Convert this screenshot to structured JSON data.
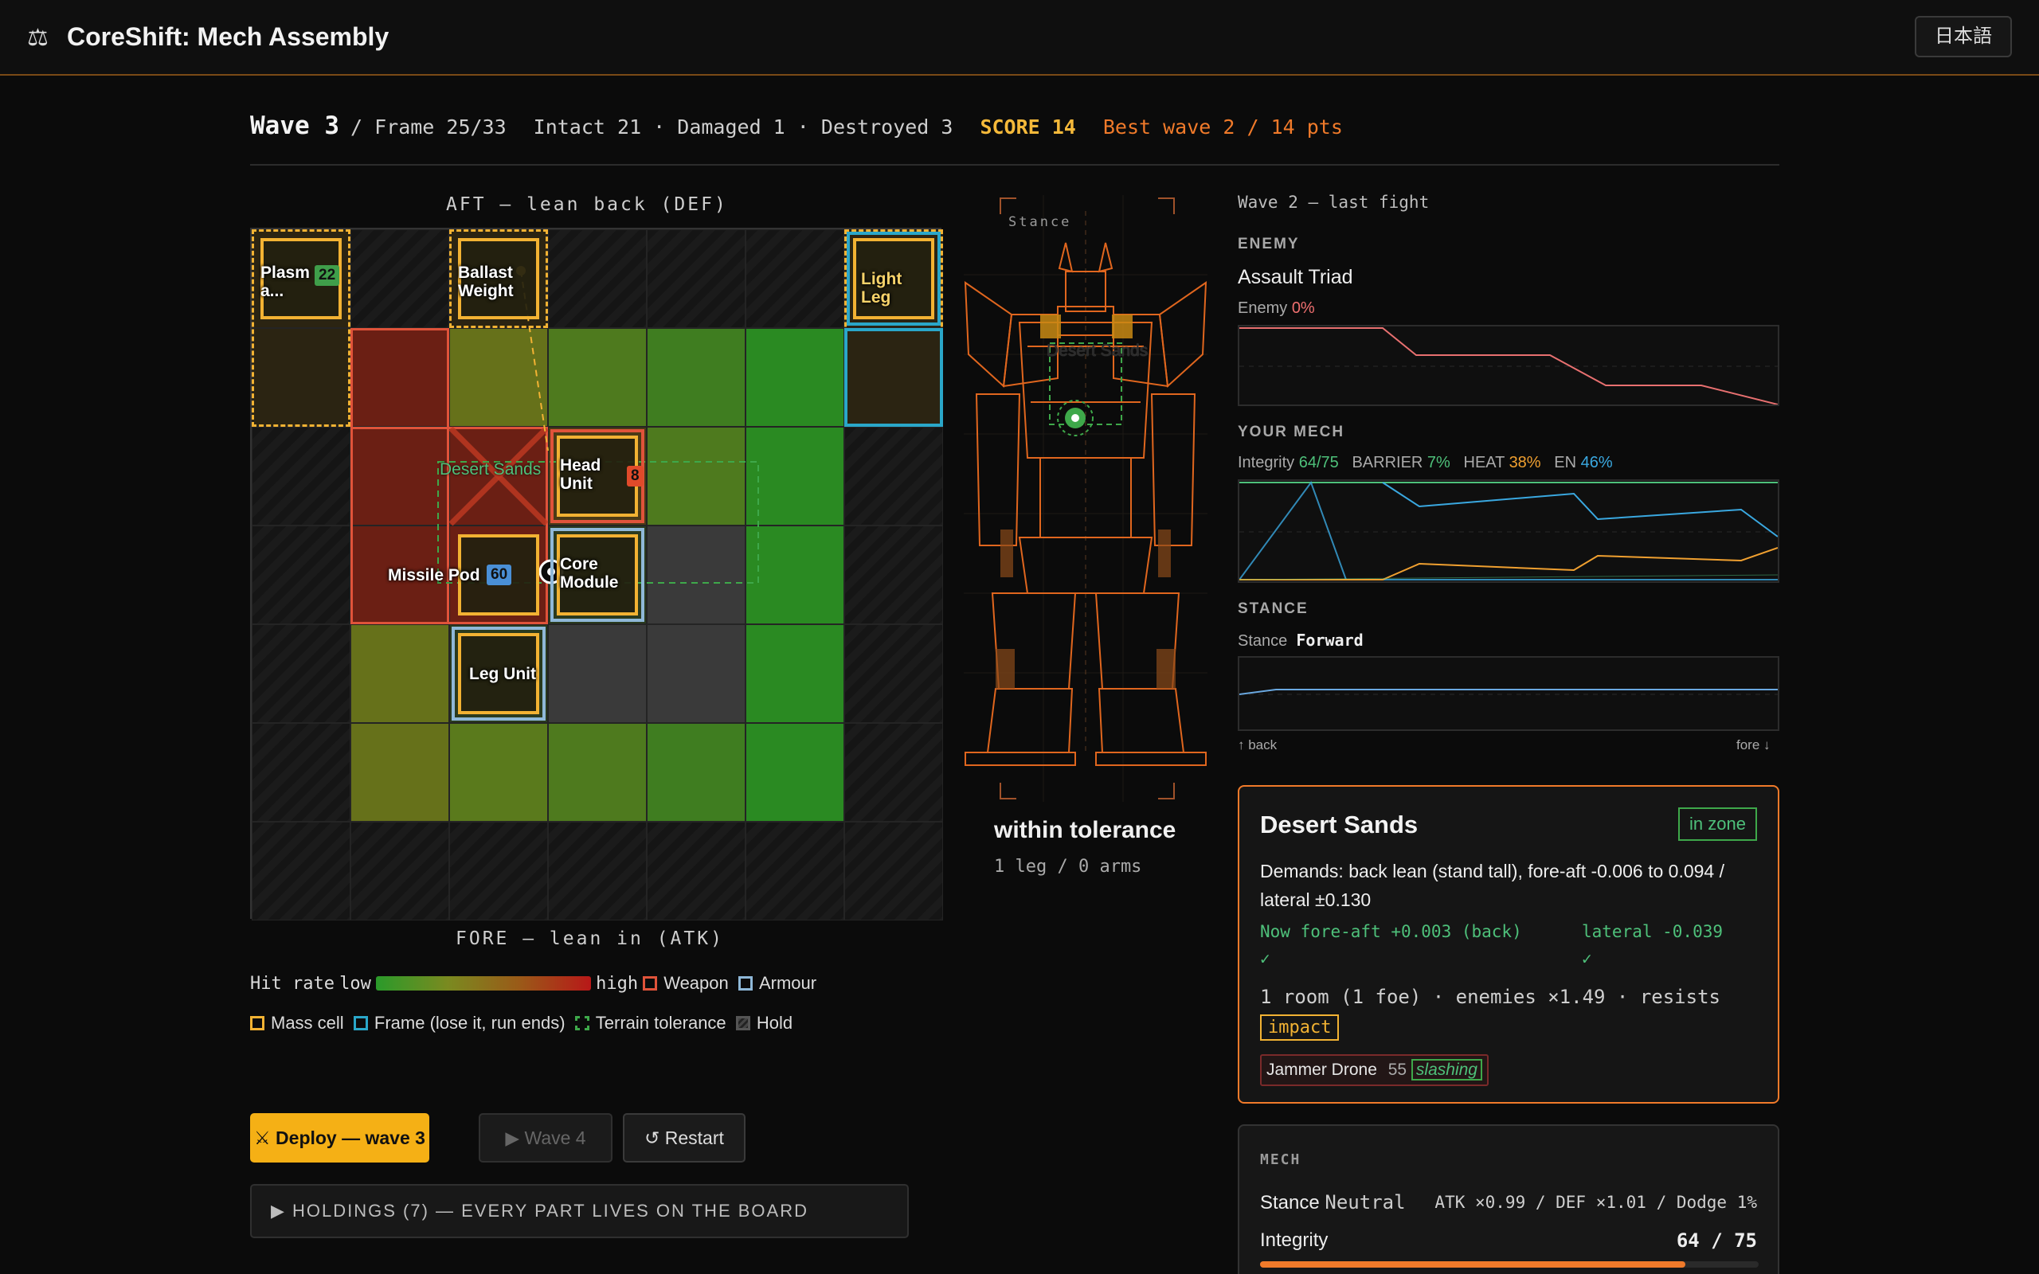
{
  "header": {
    "logo": "⚖",
    "title": "CoreShift: Mech Assembly",
    "lang_button": "日本語"
  },
  "status": {
    "wave": "Wave 3",
    "frame": "/ Frame 25/33",
    "counts": "Intact 21 · Damaged 1 · Destroyed 3",
    "score": "SCORE 14",
    "best": "Best wave 2 / 14 pts"
  },
  "board": {
    "top_label": "AFT — lean back (DEF)",
    "bottom_label": "FORE — lean in (ATK)",
    "terrain_zone_label": "Desert Sands",
    "pieces": [
      {
        "name": "Plasma...",
        "label": "Plasm\na...",
        "badge": "22",
        "badge_color": "#3f9e4a"
      },
      {
        "name": "Ballast Weight",
        "label": "Ballast\nWeight"
      },
      {
        "name": "Light Leg",
        "label": "Light Leg"
      },
      {
        "name": "Head Unit",
        "label": "Head\nUnit",
        "badge": "8",
        "badge_color": "#e04a2a"
      },
      {
        "name": "Missile Pod",
        "label": "Missile Pod",
        "badge": "60",
        "badge_color": "#4a8fd6"
      },
      {
        "name": "Core Module",
        "label": "Core\nModule"
      },
      {
        "name": "Leg Unit",
        "label": "Leg Unit"
      }
    ]
  },
  "legend": {
    "hit_rate": "Hit rate",
    "low": "low",
    "high": "high",
    "weapon": "Weapon",
    "armour": "Armour",
    "mass_cell": "Mass cell",
    "frame": "Frame (lose it, run ends)",
    "terrain": "Terrain tolerance",
    "hold": "Hold"
  },
  "buttons": {
    "deploy": "⚔ Deploy — wave 3",
    "wave4": "▶ Wave 4",
    "restart": "↺ Restart"
  },
  "holdings": "▶ HOLDINGS (7) — EVERY PART LIVES ON THE BOARD",
  "mech": {
    "stance_caption": "Stance",
    "terrain_overlay": "Desert Sands",
    "tolerance": "within tolerance",
    "limbs": "1 leg / 0 arms"
  },
  "panel": {
    "last_fight": "Wave 2 — last fight",
    "enemy_heading": "ENEMY",
    "enemy_name": "Assault Triad",
    "enemy_label": "Enemy",
    "enemy_value": "0%",
    "your_mech_heading": "YOUR MECH",
    "integrity_label": "Integrity",
    "integrity_value": "64/75",
    "barrier_label": "BARRIER",
    "barrier_value": "7%",
    "heat_label": "HEAT",
    "heat_value": "38%",
    "en_label": "EN",
    "en_value": "46%",
    "stance_heading": "STANCE",
    "stance_label": "Stance",
    "stance_value": "Forward",
    "back": "↑ back",
    "fore": "fore ↓"
  },
  "terrain_card": {
    "title": "Desert Sands",
    "badge": "in zone",
    "demands": "Demands: back lean (stand tall), fore-aft -0.006 to 0.094 / lateral ±0.130",
    "now_fore_aft": "Now fore-aft +0.003 (back)",
    "lateral": "lateral -0.039",
    "check": "✓",
    "room": "1 room (1 foe) · enemies ×1.49 · resists",
    "resist": "impact",
    "foe_name": "Jammer Drone",
    "foe_hp": "55",
    "foe_type": "slashing"
  },
  "mech_card": {
    "heading": "MECH",
    "stance_label": "Stance",
    "stance_value": "Neutral",
    "stance_stats": "ATK ×0.99 / DEF ×1.01 / Dodge 1%",
    "integrity_label": "Integrity",
    "integrity_value": "64 / 75",
    "integrity_fraction": 0.853
  },
  "colors": {
    "accent": "#f5b015",
    "orange": "#f07a2a",
    "weapon": "#e0533a",
    "armour": "#8fb8d8",
    "mass": "#f2b233",
    "frame": "#2aa7c9",
    "terrain": "#3ea84a",
    "positive": "#4ec07a",
    "heat": "#f0a030",
    "energy": "#3aa8e0"
  }
}
